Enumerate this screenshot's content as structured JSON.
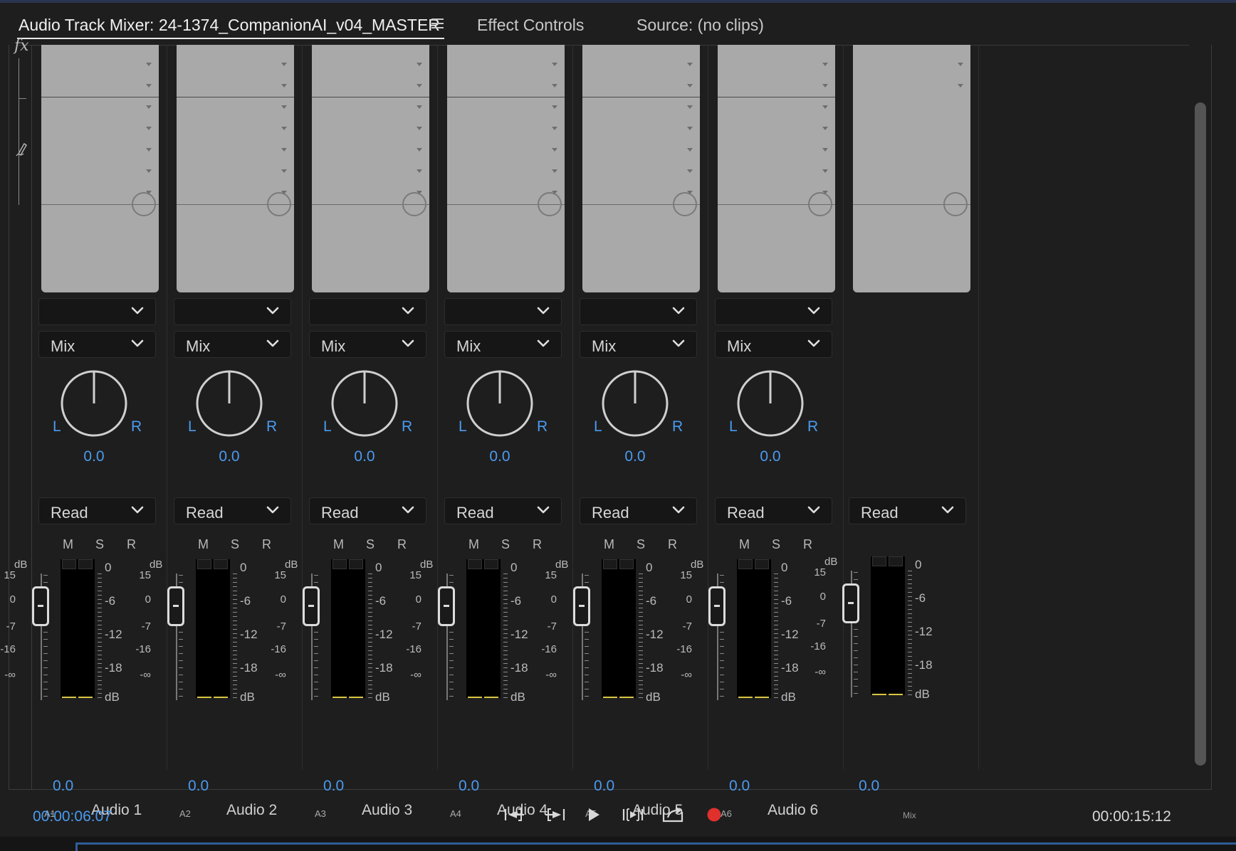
{
  "tabs": [
    {
      "label": "Audio Track Mixer: 24-1374_CompanionAI_v04_MASTER"
    },
    {
      "label": "Effect Controls"
    },
    {
      "label": "Source: (no clips)"
    }
  ],
  "side": {
    "fx_label": "fx"
  },
  "pan": {
    "left": "L",
    "right": "R"
  },
  "msr": {
    "mute": "M",
    "solo": "S",
    "record": "R"
  },
  "fader_scale": [
    "dB",
    "15",
    "0",
    "-7",
    "-16",
    "-∞"
  ],
  "meter_scale": [
    "0",
    "-6",
    "-12",
    "-18",
    "dB"
  ],
  "channels": [
    {
      "send": "",
      "mode": "Mix",
      "pan_value": "0.0",
      "automation": "Read",
      "volume": "0.0",
      "id": "A1",
      "name": "Audio 1"
    },
    {
      "send": "",
      "mode": "Mix",
      "pan_value": "0.0",
      "automation": "Read",
      "volume": "0.0",
      "id": "A2",
      "name": "Audio 2"
    },
    {
      "send": "",
      "mode": "Mix",
      "pan_value": "0.0",
      "automation": "Read",
      "volume": "0.0",
      "id": "A3",
      "name": "Audio 3"
    },
    {
      "send": "",
      "mode": "Mix",
      "pan_value": "0.0",
      "automation": "Read",
      "volume": "0.0",
      "id": "A4",
      "name": "Audio 4"
    },
    {
      "send": "",
      "mode": "Mix",
      "pan_value": "0.0",
      "automation": "Read",
      "volume": "0.0",
      "id": "A5",
      "name": "Audio 5"
    },
    {
      "send": "",
      "mode": "Mix",
      "pan_value": "0.0",
      "automation": "Read",
      "volume": "0.0",
      "id": "A6",
      "name": "Audio 6"
    }
  ],
  "master": {
    "automation": "Read",
    "volume": "0.0",
    "name": "Mix"
  },
  "transport": {
    "current_time": "00:00:06:07",
    "duration": "00:00:15:12",
    "buttons": [
      "go-to-in-icon",
      "go-to-out-icon",
      "play-icon",
      "loop-in-out-icon",
      "export-icon",
      "record-icon"
    ]
  },
  "colors": {
    "accent": "#4a9bf0",
    "record": "#e0302c",
    "meter_signal": "#d8c640"
  }
}
